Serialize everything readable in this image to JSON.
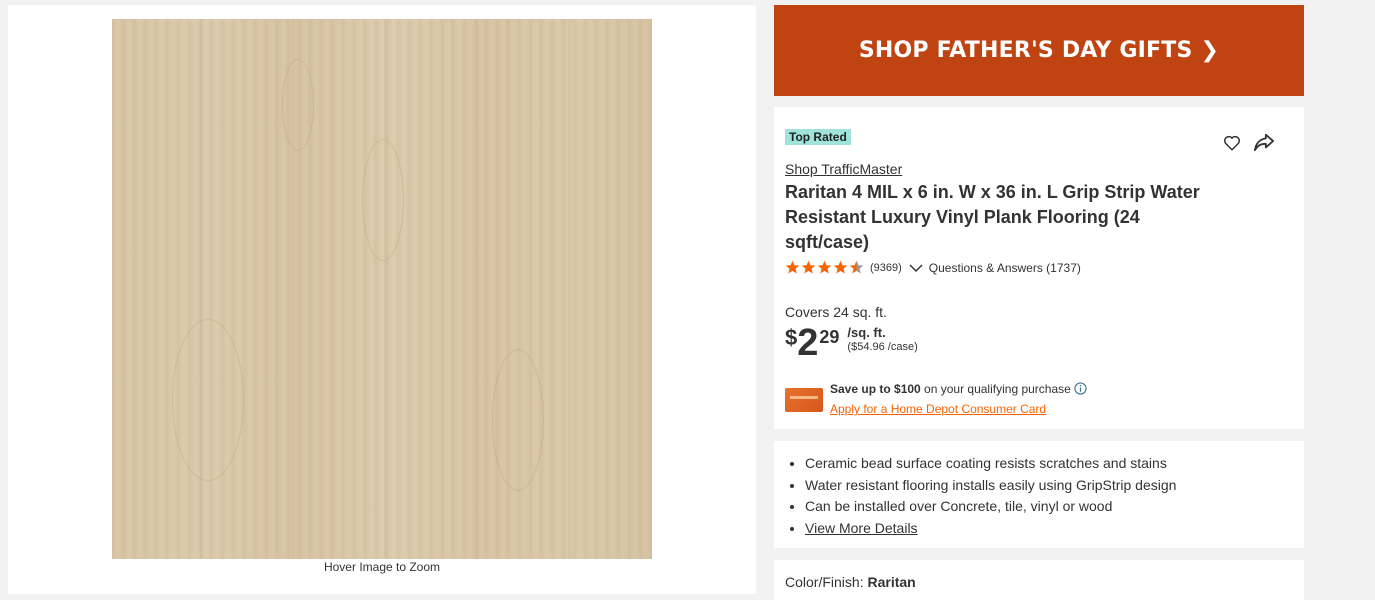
{
  "image": {
    "hover_hint": "Hover Image to Zoom"
  },
  "promo": {
    "label": "SHOP FATHER'S DAY GIFTS",
    "chevron": "❯",
    "color": "#c04412"
  },
  "product": {
    "badge": "Top Rated",
    "brand_link": "Shop TrafficMaster",
    "title": "Raritan 4 MIL x 6 in. W x 36 in. L Grip Strip Water Resistant Luxury Vinyl Plank Flooring (24 sqft/case)",
    "rating": 4.5,
    "review_count": "(9369)",
    "qa_link": "Questions & Answers (1737)",
    "covers": "Covers 24 sq. ft.",
    "price": {
      "dollar_sign": "$",
      "whole": "2",
      "cents": "29",
      "unit": "/sq. ft.",
      "per_case": "($54.96 /case)"
    },
    "financing": {
      "save_bold": "Save up to $100",
      "save_rest": " on your qualifying purchase",
      "apply_link": "Apply for a Home Depot Consumer Card"
    },
    "icons": {
      "favorite": "heart-icon",
      "share": "share-icon",
      "info": "info-icon"
    }
  },
  "details": {
    "bullets": [
      "Ceramic bead surface coating resists scratches and stains",
      "Water resistant flooring installs easily using GripStrip design",
      "Can be installed over Concrete, tile, vinyl or wood"
    ],
    "more_link": "View More Details"
  },
  "color_finish": {
    "label": "Color/Finish: ",
    "value": "Raritan"
  },
  "colors": {
    "accent_orange": "#f96302",
    "star_orange": "#f96302",
    "badge_teal": "#9fe3db"
  }
}
